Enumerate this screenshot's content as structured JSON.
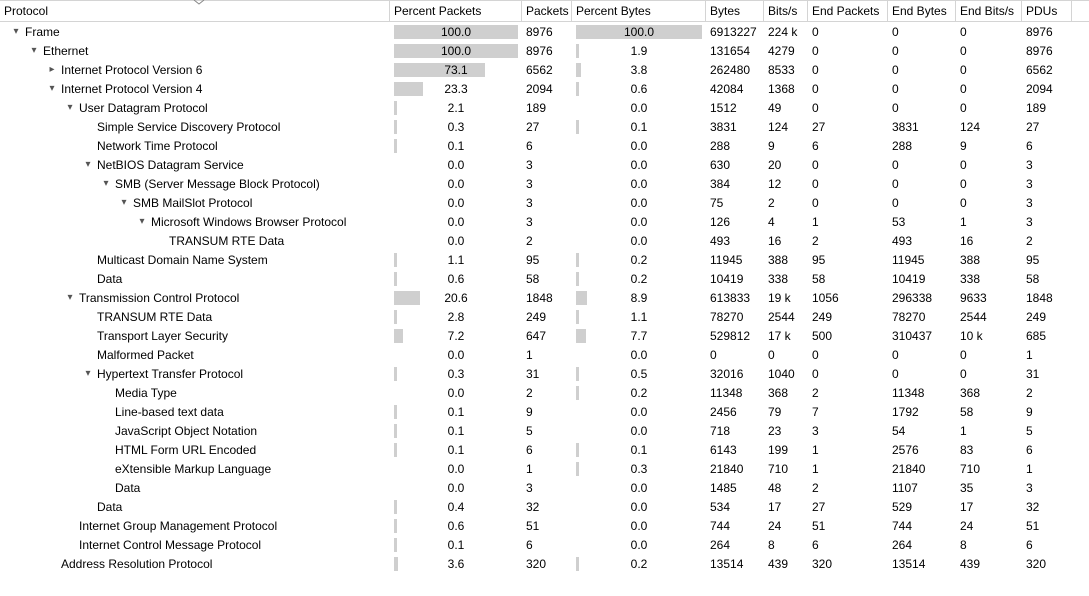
{
  "columns": {
    "protocol": "Protocol",
    "percent_packets": "Percent Packets",
    "packets": "Packets",
    "percent_bytes": "Percent Bytes",
    "bytes": "Bytes",
    "bits_s": "Bits/s",
    "end_packets": "End Packets",
    "end_bytes": "End Bytes",
    "end_bits_s": "End Bits/s",
    "pdus": "PDUs"
  },
  "rows": [
    {
      "indent": 0,
      "toggle": "down",
      "name": "Frame",
      "ppkt": 100.0,
      "pkt": "8976",
      "pbyte": 100.0,
      "byte": "6913227",
      "bits": "224 k",
      "epkt": "0",
      "ebyte": "0",
      "ebits": "0",
      "pdu": "8976"
    },
    {
      "indent": 1,
      "toggle": "down",
      "name": "Ethernet",
      "ppkt": 100.0,
      "pkt": "8976",
      "pbyte": 1.9,
      "byte": "131654",
      "bits": "4279",
      "epkt": "0",
      "ebyte": "0",
      "ebits": "0",
      "pdu": "8976"
    },
    {
      "indent": 2,
      "toggle": "right",
      "name": "Internet Protocol Version 6",
      "ppkt": 73.1,
      "pkt": "6562",
      "pbyte": 3.8,
      "byte": "262480",
      "bits": "8533",
      "epkt": "0",
      "ebyte": "0",
      "ebits": "0",
      "pdu": "6562"
    },
    {
      "indent": 2,
      "toggle": "down",
      "name": "Internet Protocol Version 4",
      "ppkt": 23.3,
      "pkt": "2094",
      "pbyte": 0.6,
      "byte": "42084",
      "bits": "1368",
      "epkt": "0",
      "ebyte": "0",
      "ebits": "0",
      "pdu": "2094"
    },
    {
      "indent": 3,
      "toggle": "down",
      "name": "User Datagram Protocol",
      "ppkt": 2.1,
      "pkt": "189",
      "pbyte": 0.0,
      "byte": "1512",
      "bits": "49",
      "epkt": "0",
      "ebyte": "0",
      "ebits": "0",
      "pdu": "189"
    },
    {
      "indent": 4,
      "toggle": "none",
      "name": "Simple Service Discovery Protocol",
      "ppkt": 0.3,
      "pkt": "27",
      "pbyte": 0.1,
      "byte": "3831",
      "bits": "124",
      "epkt": "27",
      "ebyte": "3831",
      "ebits": "124",
      "pdu": "27"
    },
    {
      "indent": 4,
      "toggle": "none",
      "name": "Network Time Protocol",
      "ppkt": 0.1,
      "pkt": "6",
      "pbyte": 0.0,
      "byte": "288",
      "bits": "9",
      "epkt": "6",
      "ebyte": "288",
      "ebits": "9",
      "pdu": "6"
    },
    {
      "indent": 4,
      "toggle": "down",
      "name": "NetBIOS Datagram Service",
      "ppkt": 0.0,
      "pkt": "3",
      "pbyte": 0.0,
      "byte": "630",
      "bits": "20",
      "epkt": "0",
      "ebyte": "0",
      "ebits": "0",
      "pdu": "3"
    },
    {
      "indent": 5,
      "toggle": "down",
      "name": "SMB (Server Message Block Protocol)",
      "ppkt": 0.0,
      "pkt": "3",
      "pbyte": 0.0,
      "byte": "384",
      "bits": "12",
      "epkt": "0",
      "ebyte": "0",
      "ebits": "0",
      "pdu": "3"
    },
    {
      "indent": 6,
      "toggle": "down",
      "name": "SMB MailSlot Protocol",
      "ppkt": 0.0,
      "pkt": "3",
      "pbyte": 0.0,
      "byte": "75",
      "bits": "2",
      "epkt": "0",
      "ebyte": "0",
      "ebits": "0",
      "pdu": "3"
    },
    {
      "indent": 7,
      "toggle": "down",
      "name": "Microsoft Windows Browser Protocol",
      "ppkt": 0.0,
      "pkt": "3",
      "pbyte": 0.0,
      "byte": "126",
      "bits": "4",
      "epkt": "1",
      "ebyte": "53",
      "ebits": "1",
      "pdu": "3"
    },
    {
      "indent": 8,
      "toggle": "none",
      "name": "TRANSUM RTE Data",
      "ppkt": 0.0,
      "pkt": "2",
      "pbyte": 0.0,
      "byte": "493",
      "bits": "16",
      "epkt": "2",
      "ebyte": "493",
      "ebits": "16",
      "pdu": "2"
    },
    {
      "indent": 4,
      "toggle": "none",
      "name": "Multicast Domain Name System",
      "ppkt": 1.1,
      "pkt": "95",
      "pbyte": 0.2,
      "byte": "11945",
      "bits": "388",
      "epkt": "95",
      "ebyte": "11945",
      "ebits": "388",
      "pdu": "95"
    },
    {
      "indent": 4,
      "toggle": "none",
      "name": "Data",
      "ppkt": 0.6,
      "pkt": "58",
      "pbyte": 0.2,
      "byte": "10419",
      "bits": "338",
      "epkt": "58",
      "ebyte": "10419",
      "ebits": "338",
      "pdu": "58"
    },
    {
      "indent": 3,
      "toggle": "down",
      "name": "Transmission Control Protocol",
      "ppkt": 20.6,
      "pkt": "1848",
      "pbyte": 8.9,
      "byte": "613833",
      "bits": "19 k",
      "epkt": "1056",
      "ebyte": "296338",
      "ebits": "9633",
      "pdu": "1848"
    },
    {
      "indent": 4,
      "toggle": "none",
      "name": "TRANSUM RTE Data",
      "ppkt": 2.8,
      "pkt": "249",
      "pbyte": 1.1,
      "byte": "78270",
      "bits": "2544",
      "epkt": "249",
      "ebyte": "78270",
      "ebits": "2544",
      "pdu": "249"
    },
    {
      "indent": 4,
      "toggle": "none",
      "name": "Transport Layer Security",
      "ppkt": 7.2,
      "pkt": "647",
      "pbyte": 7.7,
      "byte": "529812",
      "bits": "17 k",
      "epkt": "500",
      "ebyte": "310437",
      "ebits": "10 k",
      "pdu": "685"
    },
    {
      "indent": 4,
      "toggle": "none",
      "name": "Malformed Packet",
      "ppkt": 0.0,
      "pkt": "1",
      "pbyte": 0.0,
      "byte": "0",
      "bits": "0",
      "epkt": "0",
      "ebyte": "0",
      "ebits": "0",
      "pdu": "1"
    },
    {
      "indent": 4,
      "toggle": "down",
      "name": "Hypertext Transfer Protocol",
      "ppkt": 0.3,
      "pkt": "31",
      "pbyte": 0.5,
      "byte": "32016",
      "bits": "1040",
      "epkt": "0",
      "ebyte": "0",
      "ebits": "0",
      "pdu": "31"
    },
    {
      "indent": 5,
      "toggle": "none",
      "name": "Media Type",
      "ppkt": 0.0,
      "pkt": "2",
      "pbyte": 0.2,
      "byte": "11348",
      "bits": "368",
      "epkt": "2",
      "ebyte": "11348",
      "ebits": "368",
      "pdu": "2"
    },
    {
      "indent": 5,
      "toggle": "none",
      "name": "Line-based text data",
      "ppkt": 0.1,
      "pkt": "9",
      "pbyte": 0.0,
      "byte": "2456",
      "bits": "79",
      "epkt": "7",
      "ebyte": "1792",
      "ebits": "58",
      "pdu": "9"
    },
    {
      "indent": 5,
      "toggle": "none",
      "name": "JavaScript Object Notation",
      "ppkt": 0.1,
      "pkt": "5",
      "pbyte": 0.0,
      "byte": "718",
      "bits": "23",
      "epkt": "3",
      "ebyte": "54",
      "ebits": "1",
      "pdu": "5"
    },
    {
      "indent": 5,
      "toggle": "none",
      "name": "HTML Form URL Encoded",
      "ppkt": 0.1,
      "pkt": "6",
      "pbyte": 0.1,
      "byte": "6143",
      "bits": "199",
      "epkt": "1",
      "ebyte": "2576",
      "ebits": "83",
      "pdu": "6"
    },
    {
      "indent": 5,
      "toggle": "none",
      "name": "eXtensible Markup Language",
      "ppkt": 0.0,
      "pkt": "1",
      "pbyte": 0.3,
      "byte": "21840",
      "bits": "710",
      "epkt": "1",
      "ebyte": "21840",
      "ebits": "710",
      "pdu": "1"
    },
    {
      "indent": 5,
      "toggle": "none",
      "name": "Data",
      "ppkt": 0.0,
      "pkt": "3",
      "pbyte": 0.0,
      "byte": "1485",
      "bits": "48",
      "epkt": "2",
      "ebyte": "1107",
      "ebits": "35",
      "pdu": "3"
    },
    {
      "indent": 4,
      "toggle": "none",
      "name": "Data",
      "ppkt": 0.4,
      "pkt": "32",
      "pbyte": 0.0,
      "byte": "534",
      "bits": "17",
      "epkt": "27",
      "ebyte": "529",
      "ebits": "17",
      "pdu": "32"
    },
    {
      "indent": 3,
      "toggle": "none",
      "name": "Internet Group Management Protocol",
      "ppkt": 0.6,
      "pkt": "51",
      "pbyte": 0.0,
      "byte": "744",
      "bits": "24",
      "epkt": "51",
      "ebyte": "744",
      "ebits": "24",
      "pdu": "51"
    },
    {
      "indent": 3,
      "toggle": "none",
      "name": "Internet Control Message Protocol",
      "ppkt": 0.1,
      "pkt": "6",
      "pbyte": 0.0,
      "byte": "264",
      "bits": "8",
      "epkt": "6",
      "ebyte": "264",
      "ebits": "8",
      "pdu": "6"
    },
    {
      "indent": 2,
      "toggle": "none",
      "name": "Address Resolution Protocol",
      "ppkt": 3.6,
      "pkt": "320",
      "pbyte": 0.2,
      "byte": "13514",
      "bits": "439",
      "epkt": "320",
      "ebyte": "13514",
      "ebits": "439",
      "pdu": "320"
    }
  ]
}
